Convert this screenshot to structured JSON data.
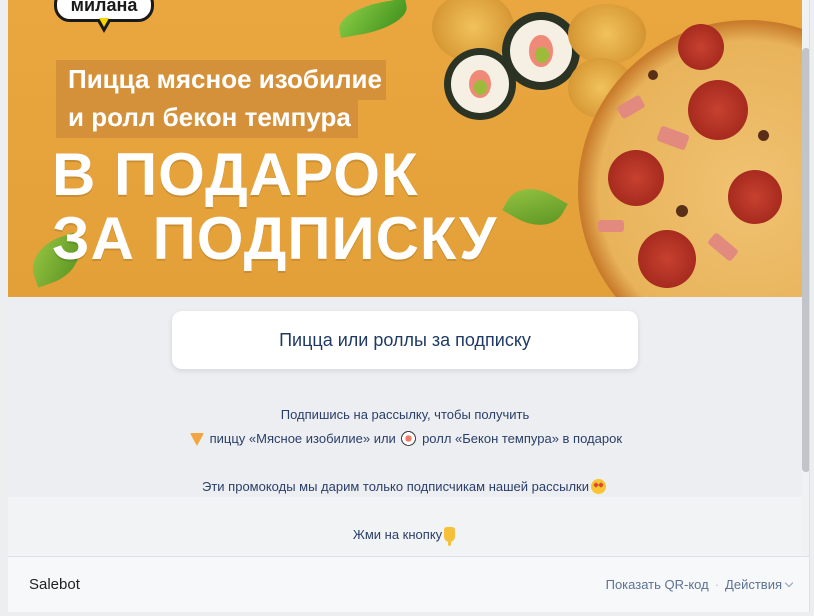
{
  "banner": {
    "logo_text": "милана",
    "promo_line1": "Пицца мясное изобилие",
    "promo_line2": "и ролл бекон темпура",
    "gift_line1": "В ПОДАРОК",
    "gift_line2": "ЗА ПОДПИСКУ",
    "colors": {
      "background": "#e4a038",
      "label_box": "#d4913a"
    }
  },
  "cta_button": {
    "label": "Пицца или роллы за подписку"
  },
  "message": {
    "line1": "Подпишись на рассылку, чтобы получить",
    "line2_part1": "пиццу «Мясное изобилие» или",
    "line2_part2": "ролл «Бекон темпура» в подарок",
    "line3": "Эти промокоды мы дарим только подписчикам нашей рассылки",
    "line4": "Жми на кнопку",
    "emoji": {
      "pizza": "pizza-emoji",
      "sushi": "sushi-emoji",
      "star_eyes": "star-struck-emoji",
      "pointing_down": "pointing-down-emoji"
    }
  },
  "footer": {
    "bot_name": "Salebot",
    "show_qr": "Показать QR-код",
    "separator": "·",
    "actions": "Действия"
  },
  "colors": {
    "text_primary": "#1f3a64",
    "link": "#5b7394",
    "page_bg": "#eceef1"
  }
}
